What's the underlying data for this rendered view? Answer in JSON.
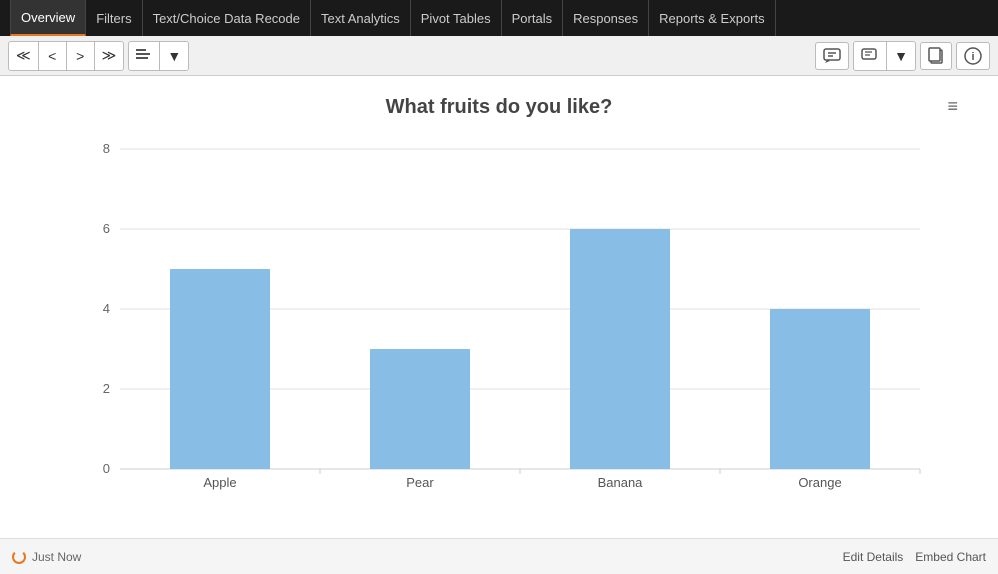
{
  "nav": {
    "items": [
      {
        "label": "Overview",
        "active": true
      },
      {
        "label": "Filters",
        "active": false
      },
      {
        "label": "Text/Choice Data Recode",
        "active": false
      },
      {
        "label": "Text Analytics",
        "active": false
      },
      {
        "label": "Pivot Tables",
        "active": false
      },
      {
        "label": "Portals",
        "active": false
      },
      {
        "label": "Responses",
        "active": false
      },
      {
        "label": "Reports & Exports",
        "active": false
      }
    ]
  },
  "toolbar": {
    "nav_first": "«",
    "nav_prev": "‹",
    "nav_next": "›",
    "nav_last": "»"
  },
  "chart": {
    "title": "What fruits do you like?",
    "menu_icon": "≡",
    "bars": [
      {
        "label": "Apple",
        "value": 5
      },
      {
        "label": "Pear",
        "value": 3
      },
      {
        "label": "Banana",
        "value": 6
      },
      {
        "label": "Orange",
        "value": 4
      }
    ],
    "y_max": 8,
    "y_ticks": [
      0,
      2,
      4,
      6,
      8
    ],
    "bar_color": "#88bde6"
  },
  "status": {
    "refresh_label": "Just Now",
    "edit_details": "Edit Details",
    "embed_chart": "Embed Chart"
  }
}
